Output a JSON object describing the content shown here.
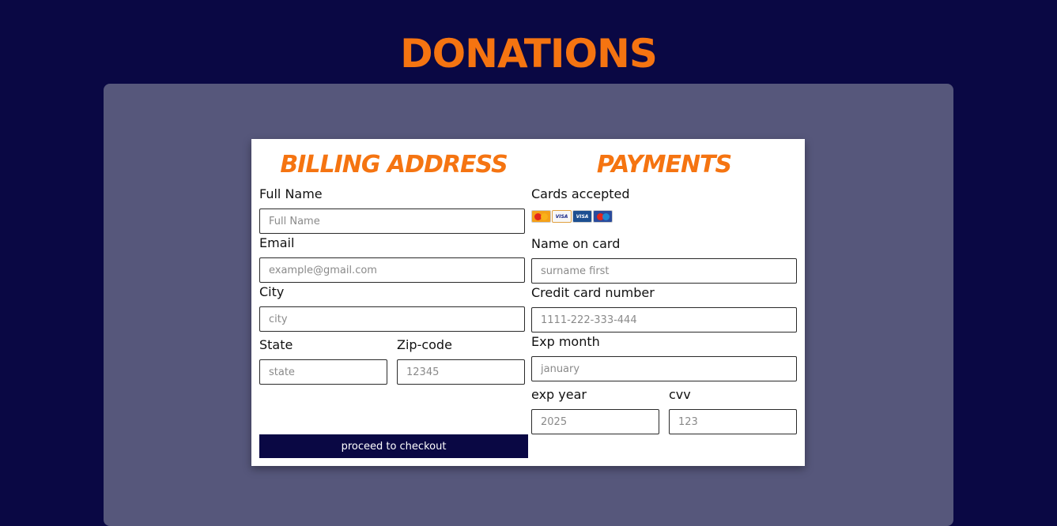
{
  "page": {
    "title": "DONATIONS"
  },
  "billing": {
    "title": "BILLING ADDRESS",
    "full_name": {
      "label": "Full Name",
      "placeholder": "Full Name"
    },
    "email": {
      "label": "Email",
      "placeholder": "example@gmail.com"
    },
    "city": {
      "label": "City",
      "placeholder": "city"
    },
    "state": {
      "label": "State",
      "placeholder": "state"
    },
    "zip": {
      "label": "Zip-code",
      "placeholder": "12345"
    }
  },
  "payments": {
    "title": "PAYMENTS",
    "cards_label": "Cards accepted",
    "cards": [
      {
        "icon": "mastercard-icon",
        "text": ""
      },
      {
        "icon": "visa-icon",
        "text": "VISA"
      },
      {
        "icon": "visa-electron-icon",
        "text": "VISA"
      },
      {
        "icon": "maestro-icon",
        "text": ""
      }
    ],
    "name_on_card": {
      "label": "Name on card",
      "placeholder": "surname first"
    },
    "card_number": {
      "label": "Credit card number",
      "placeholder": "1111-222-333-444"
    },
    "exp_month": {
      "label": "Exp month",
      "placeholder": "january"
    },
    "exp_year": {
      "label": "exp year",
      "placeholder": "2025"
    },
    "cvv": {
      "label": "cvv",
      "placeholder": "123"
    }
  },
  "actions": {
    "checkout_label": "proceed to checkout"
  },
  "colors": {
    "background": "#0a0844",
    "panel": "#56577b",
    "accent": "#f57411",
    "button": "#0a0844"
  }
}
